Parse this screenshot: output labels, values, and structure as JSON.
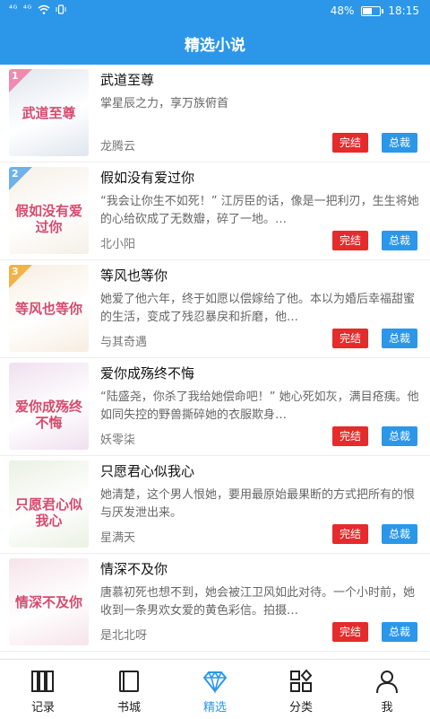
{
  "status_bar": {
    "signal_1": "⁴ᴳ",
    "signal_2": "⁴ᴳ",
    "battery_percent": "48%",
    "battery_level": 0.48,
    "time": "18:15"
  },
  "header": {
    "title": "精选小说"
  },
  "books": [
    {
      "rank": "1",
      "title": "武道至尊",
      "cover_title": "武道至尊",
      "cover_color": "#dfe6ee",
      "rank_color": "#f08bb0",
      "description": "掌星辰之力，享万族俯首",
      "author": "龙腾云",
      "status": "完结",
      "category": "总裁"
    },
    {
      "rank": "2",
      "title": "假如没有爱过你",
      "cover_title": "假如没有爱过你",
      "cover_color": "#f5efe6",
      "rank_color": "#6fb2e8",
      "description": "“我会让你生不如死！” 江厉臣的话，像是一把利刃，生生将她的心给砍成了无数瓣，碎了一地。…",
      "author": "北小阳",
      "status": "完结",
      "category": "总裁"
    },
    {
      "rank": "3",
      "title": "等风也等你",
      "cover_title": "等风也等你",
      "cover_color": "#f7ede0",
      "rank_color": "#f1b24a",
      "description": "她爱了他六年，终于如愿以偿嫁给了他。本以为婚后幸福甜蜜的生活，变成了残忍暴戾和折磨，他…",
      "author": "与其奇遇",
      "status": "完结",
      "category": "总裁"
    },
    {
      "rank": "",
      "title": "爱你成殇终不悔",
      "cover_title": "爱你成殇终不悔",
      "cover_color": "#efe0ef",
      "rank_color": "",
      "description": "“陆盛尧，你杀了我给她偿命吧！” 她心死如灰，满目疮痍。他如同失控的野兽撕碎她的衣服欺身…",
      "author": "妖零柒",
      "status": "完结",
      "category": "总裁"
    },
    {
      "rank": "",
      "title": "只愿君心似我心",
      "cover_title": "只愿君心似我心",
      "cover_color": "#eaf1e3",
      "rank_color": "",
      "description": "她清楚，这个男人恨她，要用最原始最果断的方式把所有的恨与厌发泄出来。",
      "author": "星满天",
      "status": "完结",
      "category": "总裁"
    },
    {
      "rank": "",
      "title": "情深不及你",
      "cover_title": "情深不及你",
      "cover_color": "#f6e4ea",
      "rank_color": "",
      "description": "唐慕初死也想不到，她会被江卫风如此对待。一个小时前，她收到一条男欢女爱的黄色彩信。拍摄…",
      "author": "是北北呀",
      "status": "完结",
      "category": "总裁"
    }
  ],
  "nav": [
    {
      "label": "记录",
      "icon": "books-icon",
      "active": false
    },
    {
      "label": "书城",
      "icon": "book-icon",
      "active": false
    },
    {
      "label": "精选",
      "icon": "diamond-icon",
      "active": true
    },
    {
      "label": "分类",
      "icon": "category-icon",
      "active": false
    },
    {
      "label": "我",
      "icon": "user-icon",
      "active": false
    }
  ],
  "colors": {
    "accent": "#2c97e8",
    "status_red": "#e52b2b"
  }
}
